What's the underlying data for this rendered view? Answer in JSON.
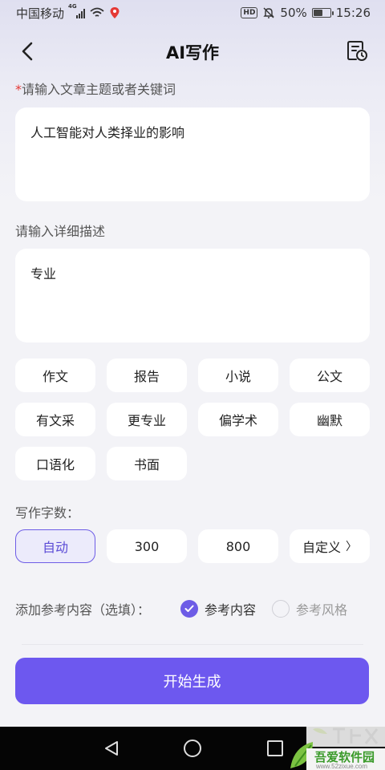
{
  "status_bar": {
    "carrier": "中国移动",
    "network": "4G",
    "hd": "HD",
    "battery_text": "50%",
    "battery_level": 0.5,
    "time": "15:26"
  },
  "header": {
    "title": "AI写作",
    "back_icon": "chevron-left-icon",
    "history_icon": "document-clock-icon"
  },
  "topic": {
    "required_mark": "*",
    "label": "请输入文章主题或者关键词",
    "value": "人工智能对人类择业的影响"
  },
  "detail": {
    "label": "请输入详细描述",
    "value": "专业"
  },
  "style_chips": [
    "作文",
    "报告",
    "小说",
    "公文",
    "有文采",
    "更专业",
    "偏学术",
    "幽默",
    "口语化",
    "书面"
  ],
  "word_count": {
    "label": "写作字数：",
    "options": [
      "自动",
      "300",
      "800",
      "自定义"
    ],
    "selected": "自动",
    "custom_arrow": "〉"
  },
  "reference": {
    "label": "添加参考内容（选填）：",
    "content_option": "参考内容",
    "content_checked": true,
    "style_option": "参考风格",
    "style_checked": false
  },
  "generate_button": "开始生成",
  "watermark": {
    "site_name": "吾爱软件园",
    "site_url": "www.52zixue.com"
  },
  "colors": {
    "accent": "#6d58ef",
    "required": "#e53935",
    "selected_bg": "#ecebfb"
  }
}
